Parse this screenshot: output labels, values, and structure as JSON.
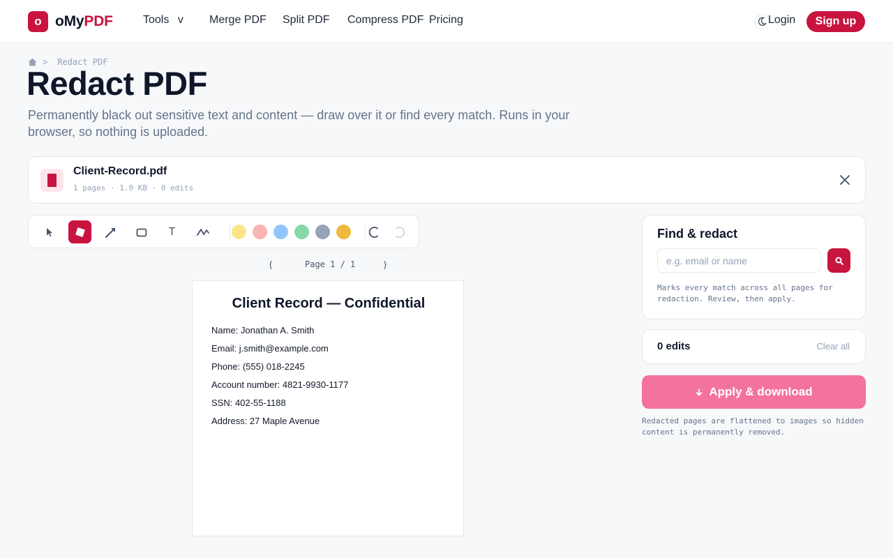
{
  "brand": {
    "mark": "o",
    "name_prefix": "oMy",
    "name_accent": "PDF",
    "accent_color": "#c8143f"
  },
  "nav": {
    "tools": "Tools",
    "tools_caret": "v",
    "merge": "Merge PDF",
    "split": "Split PDF",
    "compress": "Compress PDF",
    "pricing": "Pricing",
    "login": "Login",
    "signup": "Sign up"
  },
  "breadcrumb": {
    "separator": ">",
    "current": "Redact PDF"
  },
  "page": {
    "title": "Redact PDF",
    "subtitle": "Permanently black out sensitive text and content — draw over it or find every match. Runs in your browser, so nothing is uploaded."
  },
  "file": {
    "name": "Client-Record.pdf",
    "meta": "1 pages · 1.9 KB · 0 edits"
  },
  "toolbar": {
    "tools": [
      "select-icon",
      "redact-box-icon",
      "arrow-icon",
      "rectangle-icon",
      "text-icon",
      "freehand-icon"
    ],
    "text_tool_label": "T",
    "active_tool": "redact-box-icon",
    "colors": [
      "#fde68a",
      "#f9b4b4",
      "#93c5fd",
      "#86d9a6",
      "#94a3b8",
      "#f0b93c"
    ]
  },
  "pager": {
    "label": "Page 1 / 1",
    "prev": "(",
    "next": ")"
  },
  "document": {
    "title": "Client Record — Confidential",
    "lines": [
      "Name: Jonathan A. Smith",
      "Email: j.smith@example.com",
      "Phone: (555) 018-2245",
      "Account number: 4821-9930-1177",
      "SSN: 402-55-1188",
      "Address: 27 Maple Avenue"
    ]
  },
  "find": {
    "title": "Find & redact",
    "placeholder": "e.g. email or name",
    "value": "",
    "help": "Marks every match across all pages for redaction. Review, then apply."
  },
  "edits": {
    "count_label": "0 edits",
    "clear_label": "Clear all"
  },
  "apply": {
    "label": "Apply & download",
    "note": "Redacted pages are flattened to images so hidden content is permanently removed."
  }
}
